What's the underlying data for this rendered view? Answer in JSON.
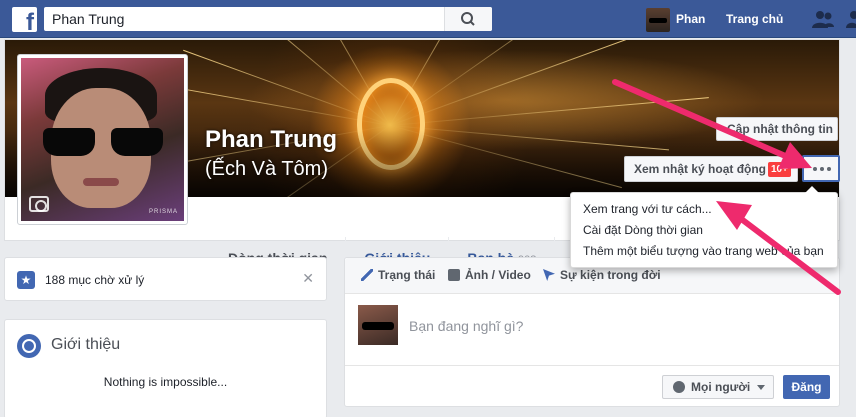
{
  "topbar": {
    "search_value": "Phan Trung",
    "user_name": "Phan",
    "home_label": "Trang chủ"
  },
  "profile": {
    "name": "Phan Trung",
    "alternate_name": "(Ếch Và Tôm)",
    "picture_watermark": "PRISMA",
    "update_info_label": "Cập nhật thông tin",
    "activity_log_label": "Xem nhật ký hoạt động",
    "activity_badge": "10+"
  },
  "tabs": [
    {
      "label": "Dòng thời gian",
      "count": ""
    },
    {
      "label": "Giới thiệu",
      "count": ""
    },
    {
      "label": "Bạn bè",
      "count": "908"
    }
  ],
  "dropdown": {
    "items": [
      "Xem trang với tư cách...",
      "Cài đặt Dòng thời gian",
      "Thêm một biểu tượng vào trang web của bạn"
    ]
  },
  "pending": {
    "text": "188 mục chờ xử lý"
  },
  "intro": {
    "title": "Giới thiệu",
    "quote": "Nothing is impossible..."
  },
  "composer": {
    "tabs": [
      "Trạng thái",
      "Ảnh / Video",
      "Sự kiện trong đời"
    ],
    "placeholder": "Bạn đang nghĩ gì?",
    "audience_label": "Mọi người",
    "post_label": "Đăng"
  },
  "colors": {
    "brand": "#3b5998",
    "button_blue": "#4267b2",
    "badge_red": "#fa3e3e",
    "annotation_arrow": "#ee2a6d"
  }
}
